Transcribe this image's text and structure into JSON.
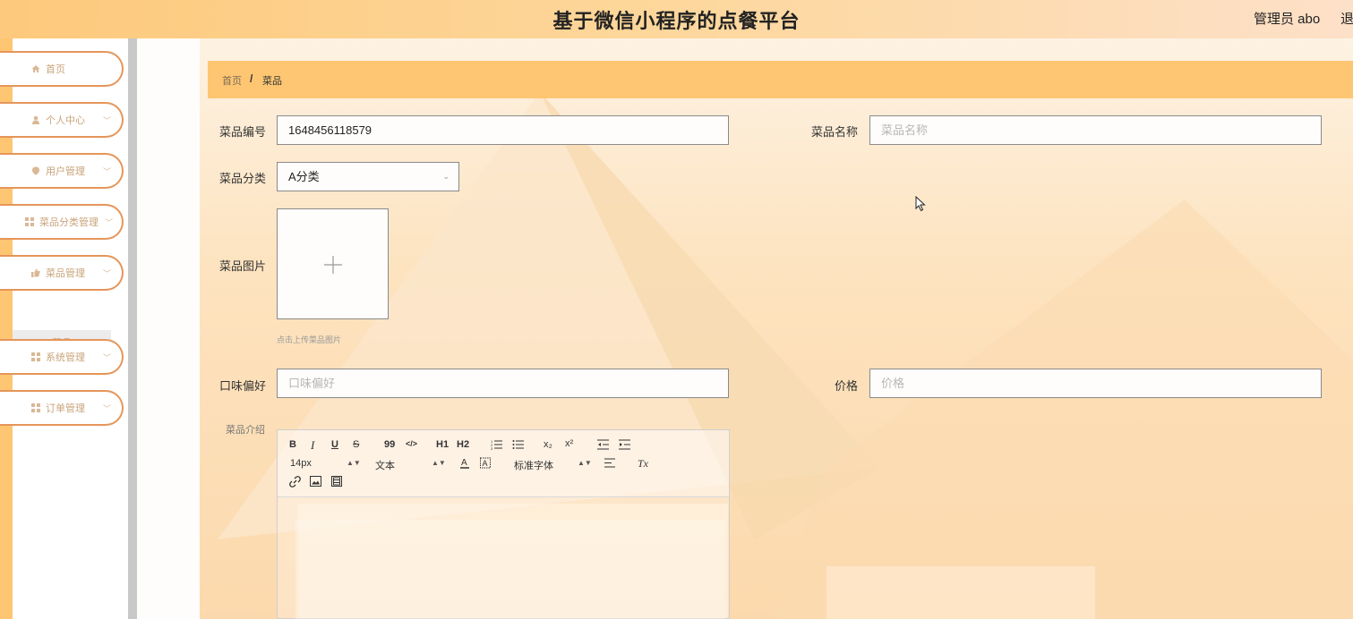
{
  "header": {
    "title": "基于微信小程序的点餐平台",
    "user": "管理员 abo",
    "logout": "退"
  },
  "sidebar": {
    "items": [
      {
        "label": "首页",
        "icon": "home-icon"
      },
      {
        "label": "个人中心",
        "icon": "user-icon"
      },
      {
        "label": "用户管理",
        "icon": "map-pin-icon"
      },
      {
        "label": "菜品分类管理",
        "icon": "grid-icon"
      },
      {
        "label": "菜品管理",
        "icon": "thumb-icon"
      },
      {
        "label": "系统管理",
        "icon": "grid-icon"
      },
      {
        "label": "订单管理",
        "icon": "grid-icon"
      }
    ],
    "sub_item": "菜品"
  },
  "breadcrumb": {
    "home": "首页",
    "sep": "/",
    "current": "菜品"
  },
  "form": {
    "code_label": "菜品编号",
    "code_value": "1648456118579",
    "name_label": "菜品名称",
    "name_placeholder": "菜品名称",
    "category_label": "菜品分类",
    "category_value": "A分类",
    "image_label": "菜品图片",
    "image_hint": "点击上传菜品图片",
    "taste_label": "口味偏好",
    "taste_placeholder": "口味偏好",
    "price_label": "价格",
    "price_placeholder": "价格",
    "intro_label": "菜品介绍"
  },
  "editor": {
    "bold": "B",
    "italic": "I",
    "underline": "U",
    "strike": "S",
    "quote": "99",
    "code": "</>",
    "h1": "H1",
    "h2": "H2",
    "sub": "x₂",
    "sup": "x²",
    "size": "14px",
    "text_type": "文本",
    "font": "标准字体",
    "clear": "Tx"
  },
  "colors": {
    "header_start": "#fdc97c",
    "accent": "#fec672",
    "menu_border": "#e6955a"
  }
}
